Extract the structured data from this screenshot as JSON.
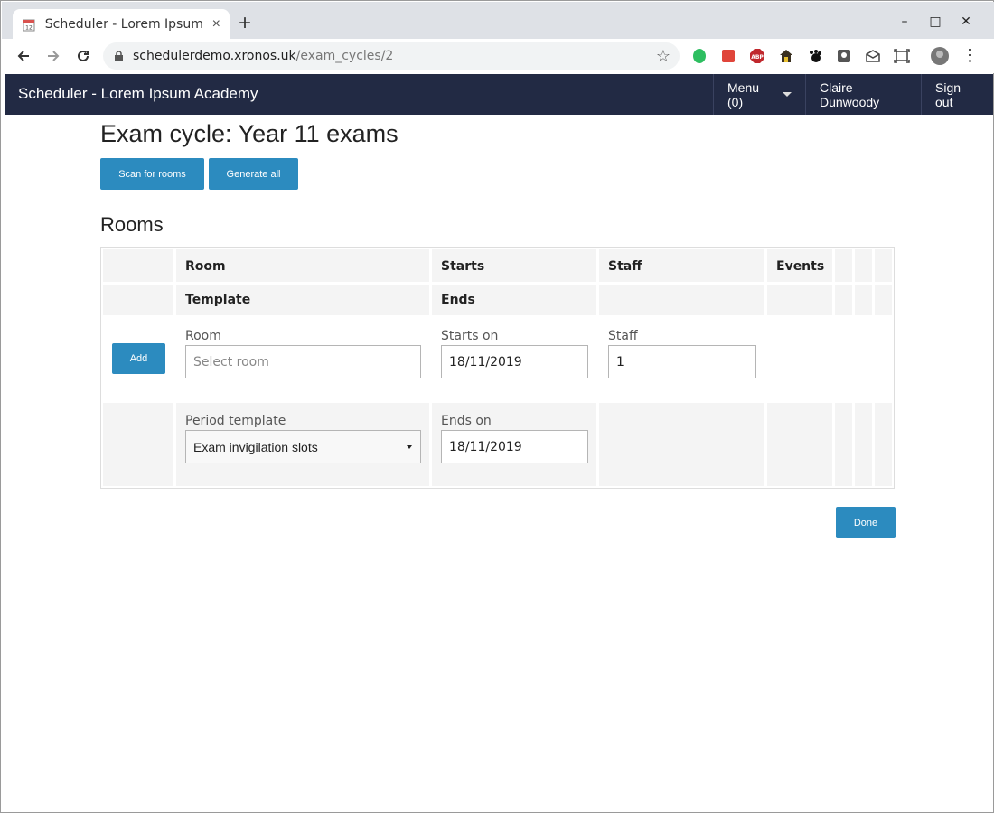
{
  "browser": {
    "tab_title": "Scheduler - Lorem Ipsum A",
    "tab_close": "×",
    "new_tab": "+",
    "url_host": "schedulerdemo.xronos.uk",
    "url_path": "/exam_cycles/2",
    "win_minimize": "–",
    "win_maximize": "□",
    "win_close": "✕"
  },
  "navbar": {
    "brand": "Scheduler - Lorem Ipsum Academy",
    "menu_label": "Menu (0)",
    "user_name": "Claire Dunwoody",
    "sign_out": "Sign out"
  },
  "page": {
    "title": "Exam cycle: Year 11 exams",
    "scan_button": "Scan for rooms",
    "generate_button": "Generate all",
    "rooms_heading": "Rooms",
    "done_button": "Done"
  },
  "table": {
    "headers_row1": [
      "Room",
      "Starts",
      "Staff",
      "Events"
    ],
    "headers_row2": [
      "Template",
      "Ends"
    ],
    "add_button": "Add",
    "room_label": "Room",
    "room_placeholder": "Select room",
    "starts_label": "Starts on",
    "starts_value": "18/11/2019",
    "staff_label": "Staff",
    "staff_value": "1",
    "template_label": "Period template",
    "template_value": "Exam invigilation slots",
    "ends_label": "Ends on",
    "ends_value": "18/11/2019"
  },
  "colors": {
    "navbar_bg": "#222a44",
    "button_bg": "#2c8bbf"
  }
}
